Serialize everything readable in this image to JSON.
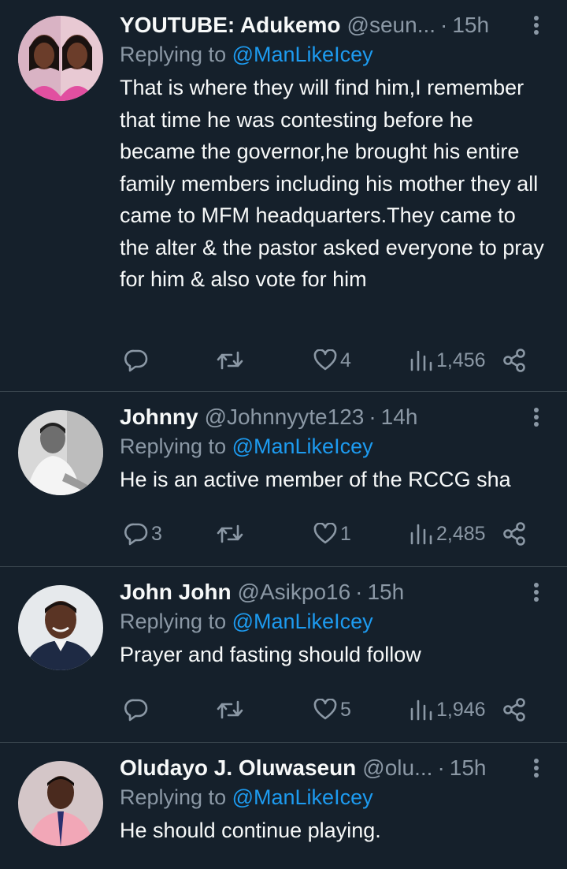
{
  "tweets": [
    {
      "name": "YOUTUBE: Adukemo",
      "handle": "@seun...",
      "sep": "·",
      "time": "15h",
      "replying_prefix": "Replying to",
      "replying_to": "@ManLikeIcey",
      "text": "That is where they will find him,I remember that time he was contesting before he became the governor,he brought his entire family members including his mother they all came to MFM headquarters.They came to the alter & the pastor asked everyone to pray for him & also vote for him",
      "replies": "",
      "retweets": "",
      "likes": "4",
      "views": "1,456"
    },
    {
      "name": "Johnny",
      "handle": "@Johnnyyte123",
      "sep": "·",
      "time": "14h",
      "replying_prefix": "Replying to",
      "replying_to": "@ManLikeIcey",
      "text": "He is an active member of the RCCG sha",
      "replies": "3",
      "retweets": "",
      "likes": "1",
      "views": "2,485"
    },
    {
      "name": "John John",
      "handle": "@Asikpo16",
      "sep": "·",
      "time": "15h",
      "replying_prefix": "Replying to",
      "replying_to": "@ManLikeIcey",
      "text": "Prayer and fasting should follow",
      "replies": "",
      "retweets": "",
      "likes": "5",
      "views": "1,946"
    },
    {
      "name": "Oludayo J. Oluwaseun",
      "handle": "@olu...",
      "sep": "·",
      "time": "15h",
      "replying_prefix": "Replying to",
      "replying_to": "@ManLikeIcey",
      "text": "He should continue playing.",
      "replies": "",
      "retweets": "",
      "likes": "",
      "views": ""
    }
  ],
  "icons": {
    "reply": "reply-icon",
    "retweet": "retweet-icon",
    "like": "heart-icon",
    "views": "views-icon",
    "share": "share-icon",
    "more": "more-icon"
  },
  "colors": {
    "background": "#15202b",
    "text": "#f7f9f9",
    "secondary": "#8b98a5",
    "mention": "#1d9bf0",
    "divider": "#38444d"
  }
}
